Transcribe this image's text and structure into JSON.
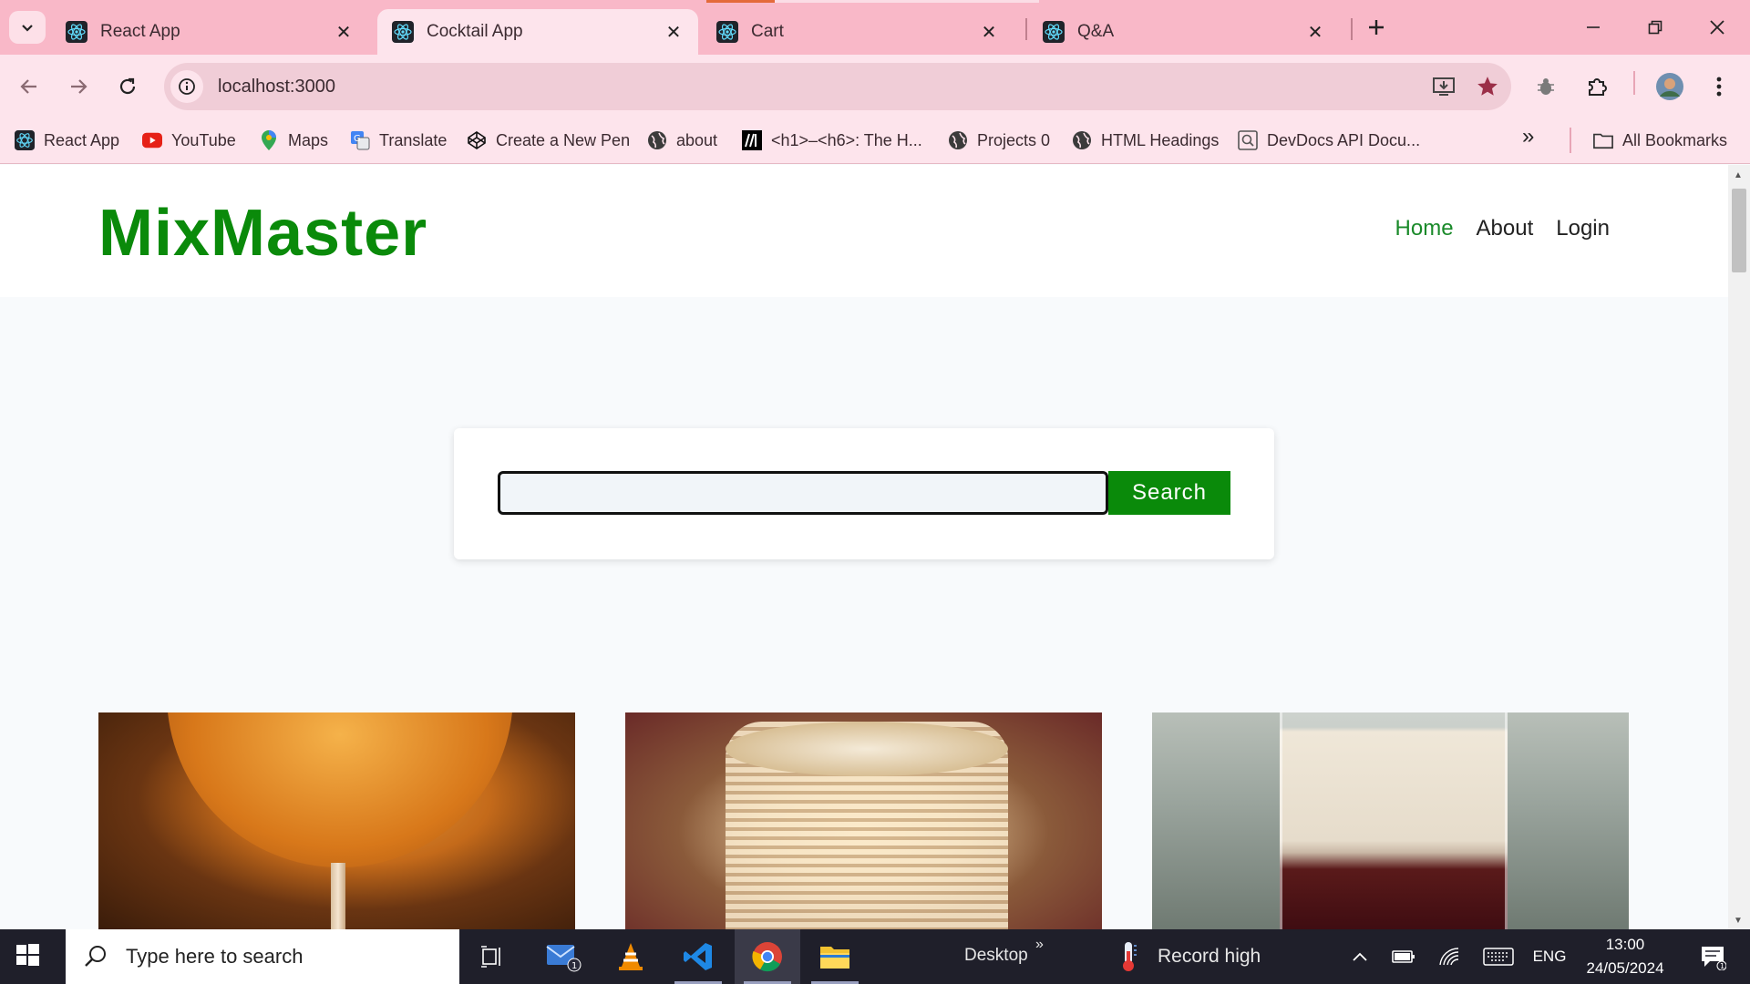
{
  "browser": {
    "tabs": [
      {
        "title": "React App",
        "active": false
      },
      {
        "title": "Cocktail App",
        "active": true
      },
      {
        "title": "Cart",
        "active": false
      },
      {
        "title": "Q&A",
        "active": false
      }
    ],
    "url": "localhost:3000",
    "bookmarks": [
      {
        "label": "React App",
        "icon": "react-icon"
      },
      {
        "label": "YouTube",
        "icon": "youtube-icon"
      },
      {
        "label": "Maps",
        "icon": "maps-pin-icon"
      },
      {
        "label": "Translate",
        "icon": "translate-icon"
      },
      {
        "label": "Create a New Pen",
        "icon": "codepen-icon"
      },
      {
        "label": "about",
        "icon": "globe-icon"
      },
      {
        "label": "<h1>–<h6>: The H...",
        "icon": "mdn-icon"
      },
      {
        "label": "Projects 0",
        "icon": "globe-icon"
      },
      {
        "label": "HTML Headings",
        "icon": "globe-icon"
      },
      {
        "label": "DevDocs API Docu...",
        "icon": "devdocs-icon"
      }
    ],
    "all_bookmarks_label": "All Bookmarks",
    "accent_color": "#f9b8c8"
  },
  "page": {
    "brand": "MixMaster",
    "nav": {
      "home": "Home",
      "about": "About",
      "login": "Login"
    },
    "search": {
      "value": "",
      "placeholder": "",
      "button_label": "Search"
    },
    "brand_color": "#0a8a0a"
  },
  "taskbar": {
    "search_placeholder": "Type here to search",
    "desktop_label": "Desktop",
    "weather_label": "Record high",
    "language": "ENG",
    "time": "13:00",
    "date": "24/05/2024",
    "mail_badge": "1",
    "notification_badge": "1"
  }
}
